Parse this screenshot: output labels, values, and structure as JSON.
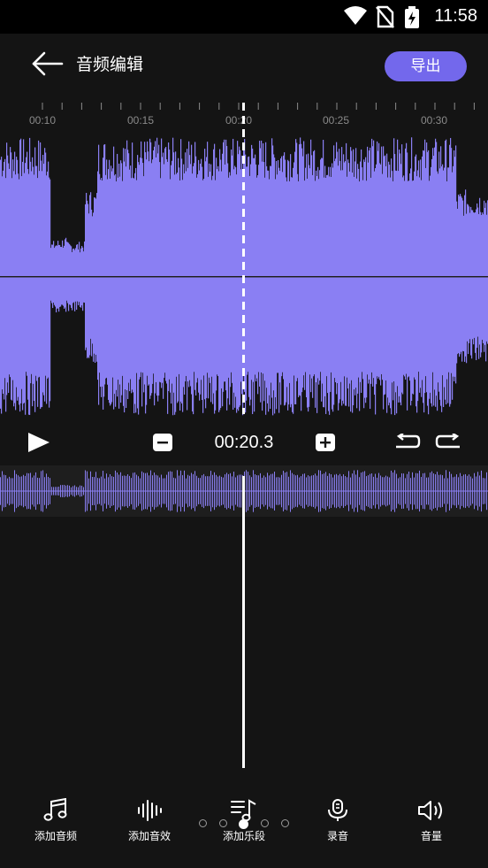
{
  "status_bar": {
    "time": "11:58"
  },
  "header": {
    "title": "音频编辑",
    "export_label": "导出"
  },
  "timeline": {
    "ticks": [
      "00:10",
      "00:15",
      "00:20",
      "00:25",
      "00:30"
    ]
  },
  "controls": {
    "timecode": "00:20.3"
  },
  "toolbar": {
    "items": [
      {
        "label": "添加音频",
        "icon": "music-note-icon"
      },
      {
        "label": "添加音效",
        "icon": "sound-wave-icon"
      },
      {
        "label": "添加乐段",
        "icon": "music-list-icon"
      },
      {
        "label": "录音",
        "icon": "microphone-icon"
      },
      {
        "label": "音量",
        "icon": "volume-icon"
      }
    ]
  },
  "pager": {
    "count": 5,
    "active": 2
  },
  "colors": {
    "accent": "#7368ec",
    "waveform": "#8a7ff3",
    "background": "#141414"
  }
}
